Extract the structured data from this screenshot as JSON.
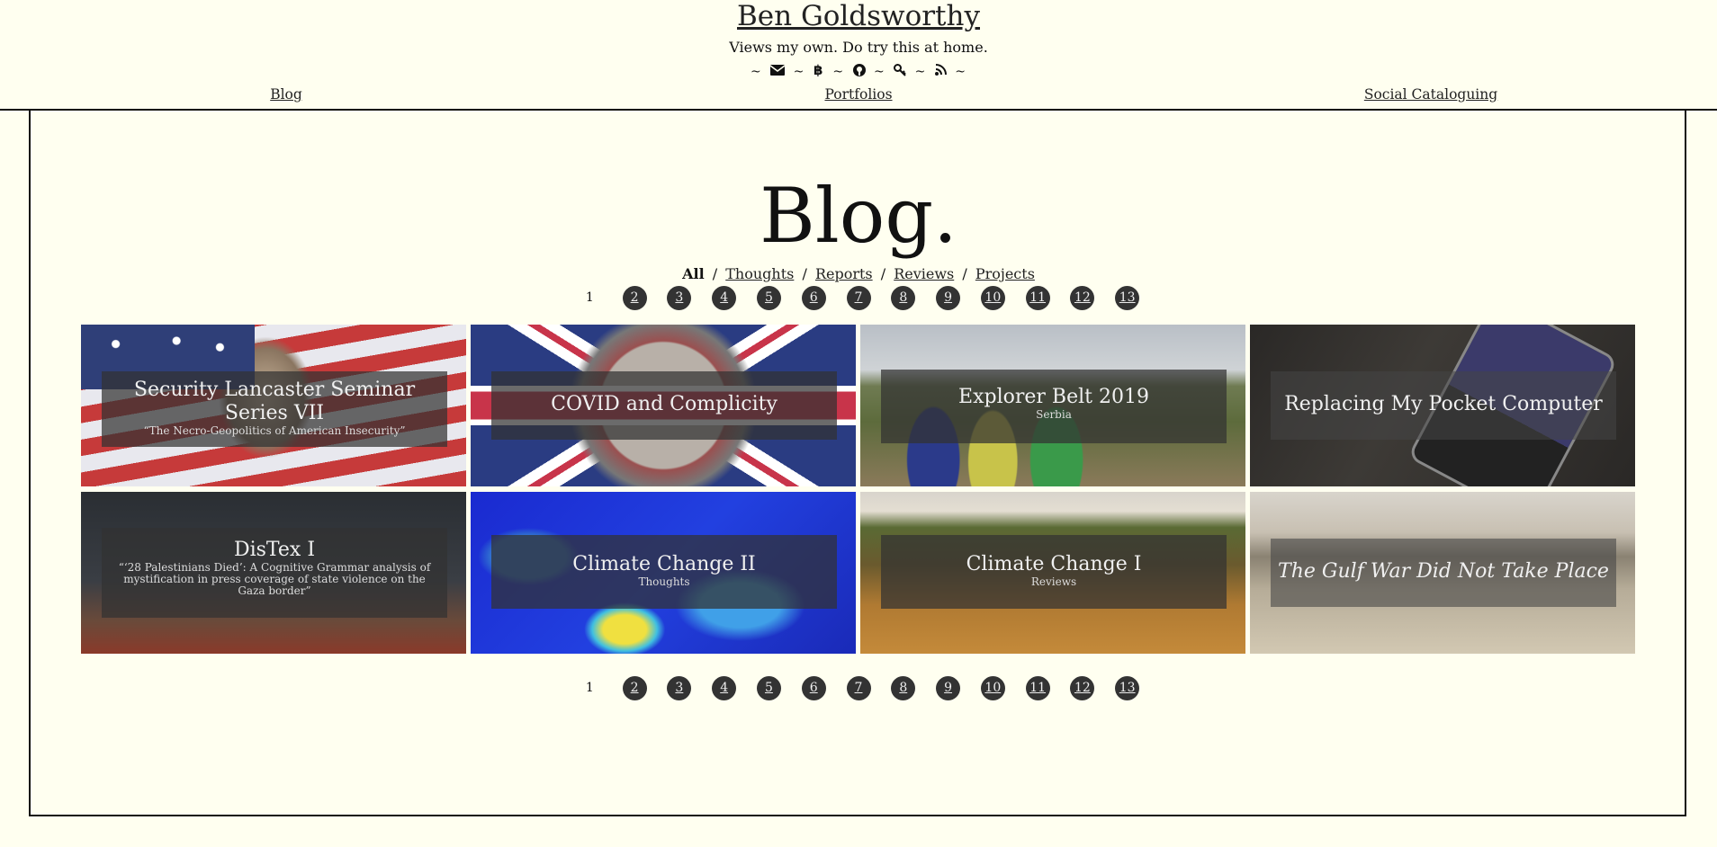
{
  "site": {
    "title": "Ben Goldsworthy",
    "tagline": "Views my own. Do try this at home.",
    "icons": [
      "email-icon",
      "bitcoin-icon",
      "github-icon",
      "key-icon",
      "rss-icon"
    ],
    "separator": "~"
  },
  "topnav": {
    "blog": "Blog",
    "portfolios": "Portfolios",
    "social": "Social Cataloguing"
  },
  "page": {
    "heading": "Blog."
  },
  "filters": {
    "active": "All",
    "separator": "/",
    "items": [
      "Thoughts",
      "Reports",
      "Reviews",
      "Projects"
    ]
  },
  "pagination": {
    "current": "1",
    "pages": [
      "2",
      "3",
      "4",
      "5",
      "6",
      "7",
      "8",
      "9",
      "10",
      "11",
      "12",
      "13"
    ]
  },
  "cards": [
    {
      "title": "Security Lancaster Seminar Series VII",
      "subtitle": "“The Necro-Geopolitics of American Insecurity”"
    },
    {
      "title": "COVID and Complicity",
      "subtitle": ""
    },
    {
      "title": "Explorer Belt 2019",
      "subtitle": "Serbia"
    },
    {
      "title": "Replacing My Pocket Computer",
      "subtitle": ""
    },
    {
      "title": "DisTex I",
      "subtitle": "“‘28 Palestinians Died’: A Cognitive Grammar analysis of mystification in press coverage of state violence on the Gaza border”"
    },
    {
      "title": "Climate Change II",
      "subtitle": "Thoughts"
    },
    {
      "title": "Climate Change I",
      "subtitle": "Reviews"
    },
    {
      "title": "The Gulf War Did Not Take Place",
      "subtitle": ""
    }
  ],
  "colors": {
    "background": "#fffff0",
    "pager_bubble": "#333333",
    "overlay": "#323232"
  }
}
